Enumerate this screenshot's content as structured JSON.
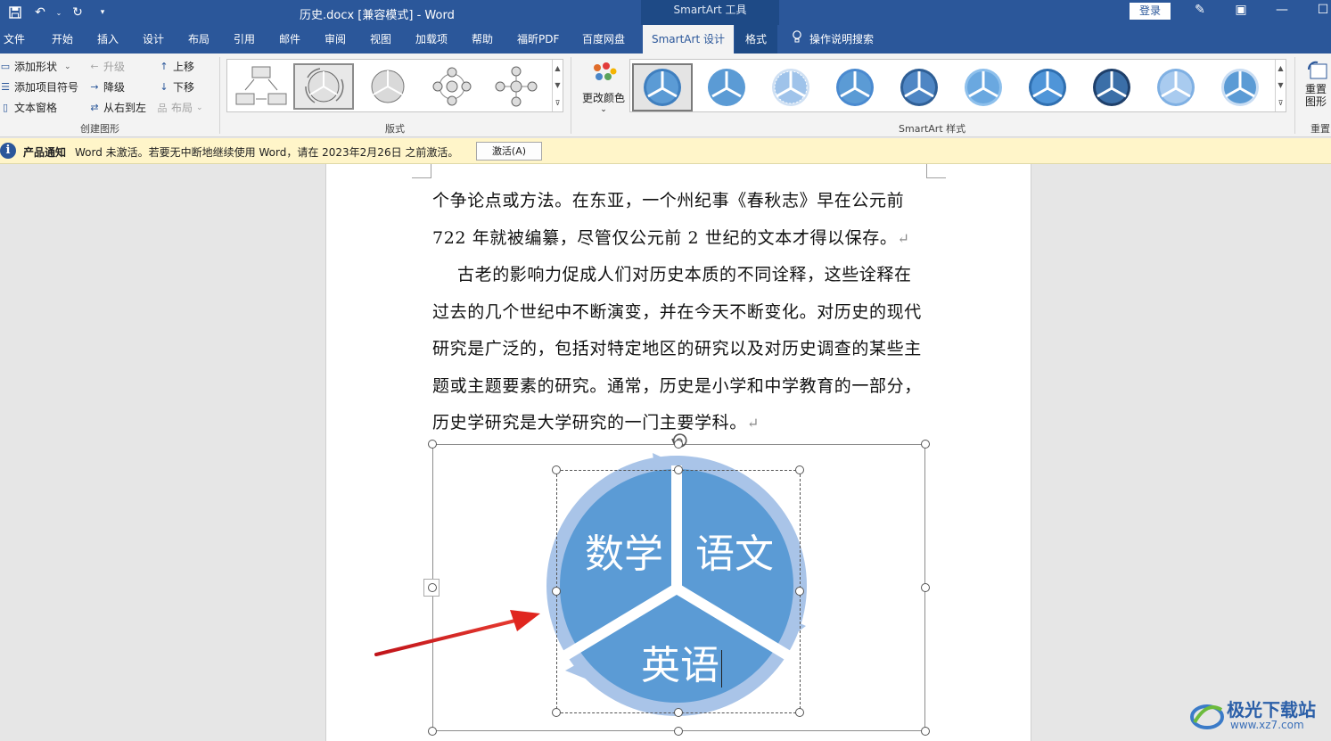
{
  "titlebar": {
    "title": "历史.docx [兼容模式] - Word",
    "contextual_group": "SmartArt 工具",
    "login_label": "登录"
  },
  "tabs": [
    {
      "label": "文件"
    },
    {
      "label": "开始"
    },
    {
      "label": "插入"
    },
    {
      "label": "设计"
    },
    {
      "label": "布局"
    },
    {
      "label": "引用"
    },
    {
      "label": "邮件"
    },
    {
      "label": "审阅"
    },
    {
      "label": "视图"
    },
    {
      "label": "加载项"
    },
    {
      "label": "帮助"
    },
    {
      "label": "福昕PDF"
    },
    {
      "label": "百度网盘"
    },
    {
      "label": "SmartArt 设计",
      "active": true
    },
    {
      "label": "格式"
    }
  ],
  "tell_me": "操作说明搜索",
  "ribbon": {
    "create_graphic": {
      "add_shape": "添加形状",
      "add_bullet": "添加项目符号",
      "text_pane": "文本窗格",
      "promote": "升级",
      "demote": "降级",
      "right_to_left": "从右到左",
      "move_up": "上移",
      "move_down": "下移",
      "layout": "布局",
      "group_label": "创建图形"
    },
    "layouts": {
      "group_label": "版式"
    },
    "styles": {
      "change_color": "更改颜色",
      "group_label": "SmartArt 样式"
    },
    "reset": {
      "label": "重置图形",
      "group_label": "重置"
    }
  },
  "notification": {
    "title": "产品通知",
    "message": "Word 未激活。若要无中断地继续使用 Word，请在 2023年2月26日 之前激活。",
    "button": "激活(A)"
  },
  "document": {
    "lines": [
      "个争论点或方法。在东亚，一个州纪事《春秋志》早在公元前",
      "722 年就被编纂，尽管仅公元前 2 世纪的文本才得以保存。",
      "古老的影响力促成人们对历史本质的不同诠释，这些诠释在",
      "过去的几个世纪中不断演变，并在今天不断变化。对历史的现代",
      "研究是广泛的，包括对特定地区的研究以及对历史调查的某些主",
      "题或主题要素的研究。通常，历史是小学和中学教育的一部分，",
      "历史学研究是大学研究的一门主要学科。"
    ]
  },
  "smartart": {
    "segments": [
      {
        "label": "数学"
      },
      {
        "label": "语文"
      },
      {
        "label": "英语"
      }
    ],
    "colors": {
      "fill": "#5b9bd5",
      "arrow": "#a9c4e8"
    }
  },
  "watermark": {
    "name": "极光下载站",
    "url": "www.xz7.com"
  }
}
